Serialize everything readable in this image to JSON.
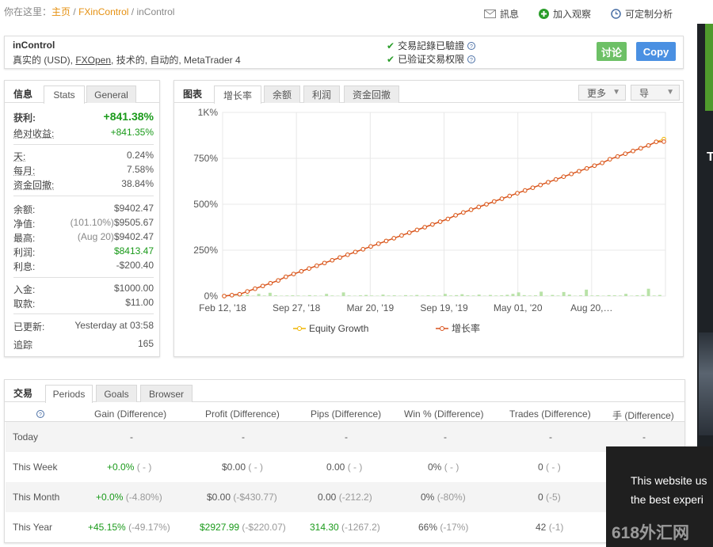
{
  "breadcrumb": {
    "prefix": "你在这里：",
    "home": "主页",
    "sep": "/",
    "site": "FXinControl",
    "current": "inControl"
  },
  "top_actions": {
    "messages": "訊息",
    "watch": "加入观察",
    "analysis": "可定制分析"
  },
  "system": {
    "name": "inControl",
    "subtitle_pre": "真实的 (USD),",
    "broker": "FXOpen",
    "subtitle_post": ", 技术的, 自动的, MetaTrader 4",
    "verified_record": "交易記錄已驗證",
    "verified_access": "已验证交易权限",
    "discuss_label": "讨论",
    "copy_label": "Copy",
    "discuss_color": "#6dc066",
    "copy_color": "#4a90e2"
  },
  "info": {
    "tabs": [
      "信息",
      "Stats",
      "General"
    ],
    "gain_label": "获利:",
    "gain_value": "+841.38%",
    "abs_gain_label": "绝对收益:",
    "abs_gain_value": "+841.35%",
    "daily_label": "天:",
    "daily_value": "0.24%",
    "monthly_label": "每月:",
    "monthly_value": "7.58%",
    "drawdown_label": "资金回撤:",
    "drawdown_value": "38.84%",
    "balance_label": "余额:",
    "balance_value": "$9402.47",
    "equity_label": "净值:",
    "equity_pct": "(101.10%)",
    "equity_value": "$9505.67",
    "highest_label": "最高:",
    "highest_date": "(Aug 20)",
    "highest_value": "$9402.47",
    "profit_label": "利润:",
    "profit_value": "$8413.47",
    "interest_label": "利息:",
    "interest_value": "-$200.40",
    "deposits_label": "入金:",
    "deposits_value": "$1000.00",
    "withdrawals_label": "取款:",
    "withdrawals_value": "$11.00",
    "updated_label": "已更新:",
    "updated_value": "Yesterday at 03:58",
    "tracking_label": "追踪",
    "tracking_value": "165"
  },
  "chart_panel": {
    "title": "图表",
    "tabs": [
      "增长率",
      "余额",
      "利润",
      "资金回撤"
    ],
    "more_label": "更多",
    "export_label": "导"
  },
  "chart_data": {
    "type": "line",
    "x_ticks": [
      "Feb 12, '18",
      "Sep 27, '18",
      "Mar 20, '19",
      "Sep 19, '19",
      "May 01, '20",
      "Aug 20,…"
    ],
    "y_ticks": [
      "0%",
      "250%",
      "500%",
      "750%",
      "1K%"
    ],
    "ylim": [
      0,
      1000
    ],
    "grid": true,
    "legend_position": "bottom",
    "series": [
      {
        "name": "Equity Growth",
        "color": "#f0b400",
        "values": [
          0,
          5,
          10,
          25,
          40,
          55,
          70,
          85,
          105,
          120,
          135,
          150,
          165,
          180,
          195,
          210,
          225,
          240,
          255,
          270,
          285,
          300,
          315,
          330,
          345,
          360,
          375,
          390,
          405,
          420,
          440,
          455,
          470,
          485,
          500,
          515,
          530,
          545,
          560,
          575,
          590,
          605,
          620,
          635,
          650,
          665,
          680,
          695,
          710,
          725,
          745,
          760,
          775,
          790,
          805,
          820,
          840,
          855
        ]
      },
      {
        "name": "增长率",
        "color": "#d9531e",
        "values": [
          0,
          5,
          10,
          25,
          40,
          55,
          70,
          85,
          105,
          120,
          135,
          150,
          165,
          180,
          195,
          210,
          225,
          240,
          255,
          270,
          285,
          300,
          315,
          330,
          345,
          360,
          375,
          390,
          405,
          420,
          440,
          455,
          470,
          485,
          500,
          515,
          530,
          545,
          560,
          575,
          590,
          605,
          620,
          635,
          650,
          665,
          680,
          695,
          710,
          725,
          745,
          760,
          775,
          790,
          805,
          820,
          840,
          841
        ]
      }
    ],
    "bars": {
      "color": "#b9e2a8",
      "values": [
        3,
        2,
        5,
        8,
        2,
        12,
        3,
        18,
        4,
        2,
        3,
        4,
        3,
        2,
        5,
        3,
        2,
        12,
        3,
        2,
        20,
        3,
        2,
        4,
        6,
        3,
        2,
        8,
        3,
        4,
        2,
        5,
        3,
        6,
        2,
        4,
        3,
        2,
        12,
        3,
        5,
        10,
        4,
        3,
        8,
        2,
        6,
        3,
        4,
        7,
        12,
        20,
        5,
        3,
        4,
        24,
        2,
        6,
        3,
        22,
        8,
        2,
        4,
        35,
        3,
        4,
        2,
        5,
        4,
        3,
        12,
        2,
        4,
        6,
        40,
        3,
        6
      ]
    }
  },
  "trades": {
    "tabs": [
      "交易",
      "Periods",
      "Goals",
      "Browser"
    ],
    "headers": [
      "Gain (Difference)",
      "Profit (Difference)",
      "Pips (Difference)",
      "Win % (Difference)",
      "Trades (Difference)",
      "手 (Difference)"
    ],
    "rows": [
      {
        "label": "Today",
        "gain": "-",
        "gain_d": "",
        "profit": "-",
        "profit_d": "",
        "pips": "-",
        "pips_d": "",
        "win": "-",
        "win_d": "",
        "trades": "-",
        "trades_d": "",
        "lots": "-"
      },
      {
        "label": "This Week",
        "gain": "+0.0%",
        "gain_d": "( - )",
        "profit": "$0.00",
        "profit_d": "( - )",
        "pips": "0.00",
        "pips_d": "( - )",
        "win": "0%",
        "win_d": "( - )",
        "trades": "0",
        "trades_d": "( - )",
        "lots": ""
      },
      {
        "label": "This Month",
        "gain": "+0.0%",
        "gain_d": "(-4.80%)",
        "profit": "$0.00",
        "profit_d": "(-$430.77)",
        "pips": "0.00",
        "pips_d": "(-212.2)",
        "win": "0%",
        "win_d": "(-80%)",
        "trades": "0",
        "trades_d": "(-5)",
        "lots": ""
      },
      {
        "label": "This Year",
        "gain": "+45.15%",
        "gain_d": "(-49.17%)",
        "profit": "$2927.99",
        "profit_d": "(-$220.07)",
        "pips": "314.30",
        "pips_d": "(-1267.2)",
        "win": "66%",
        "win_d": "(-17%)",
        "trades": "42",
        "trades_d": "(-1)",
        "lots": ""
      }
    ]
  },
  "cookie": {
    "line1": "This website us",
    "line2": "the best experi"
  },
  "right_ad": {
    "letter": "T"
  },
  "watermark": "618外汇网"
}
